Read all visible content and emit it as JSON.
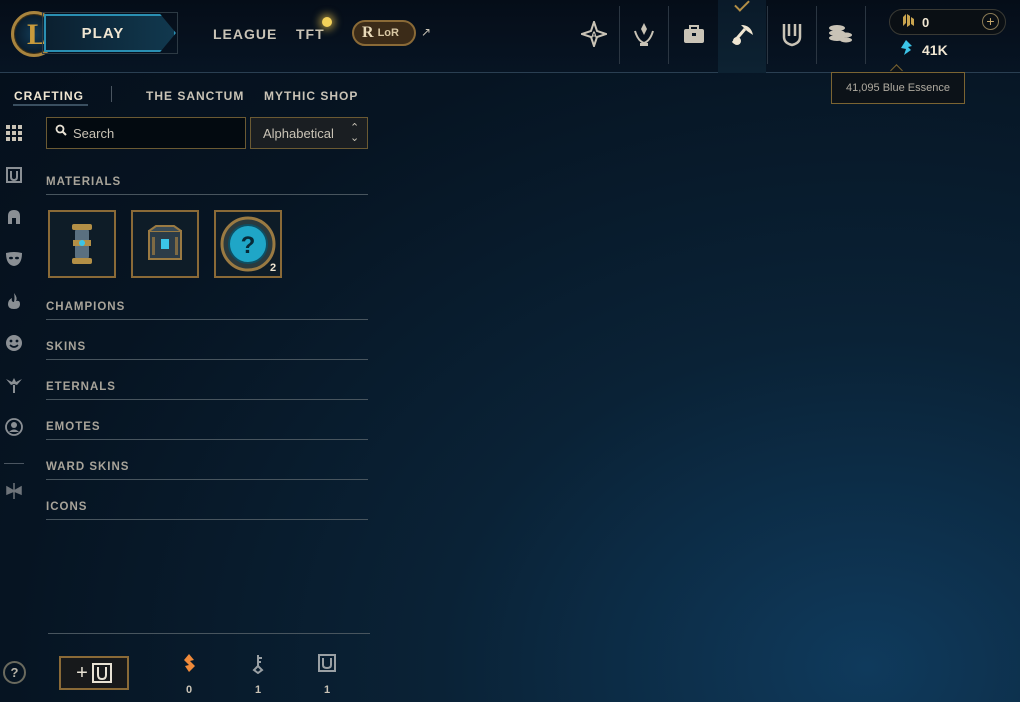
{
  "header": {
    "logo_letter": "L",
    "play_label": "PLAY",
    "nav": [
      "LEAGUE",
      "TFT"
    ],
    "lor_label": "LoR",
    "lor_glyph": "R",
    "external_glyph": "↗",
    "icons": [
      "tft-star-icon",
      "honor-icon",
      "collection-icon",
      "loot-icon",
      "store-icon",
      "currency-stack-icon"
    ]
  },
  "currency": {
    "riot_points": "0",
    "blue_essence": "41K",
    "plus": "+",
    "tooltip": "41,095 Blue Essence"
  },
  "subnav": [
    "CRAFTING",
    "THE SANCTUM",
    "MYTHIC SHOP"
  ],
  "filters": {
    "search_placeholder": "Search",
    "sort_value": "Alphabetical"
  },
  "sections": {
    "materials": "MATERIALS",
    "champions": "CHAMPIONS",
    "skins": "SKINS",
    "eternals": "ETERNALS",
    "emotes": "EMOTES",
    "ward_skins": "WARD SKINS",
    "icons": "ICONS"
  },
  "materials": [
    {
      "name": "orb-capsule",
      "count": ""
    },
    {
      "name": "chest",
      "count": ""
    },
    {
      "name": "mystery-icon",
      "count": "2"
    }
  ],
  "footer": {
    "orange_essence": "0",
    "keys": "1",
    "chests": "1",
    "add_label": "+"
  },
  "help": "?",
  "colors": {
    "gold": "#c8aa6e",
    "blue_essence": "#3bc4e8",
    "orange_essence": "#f08a3a",
    "accent_blue": "#2a8fb2"
  }
}
